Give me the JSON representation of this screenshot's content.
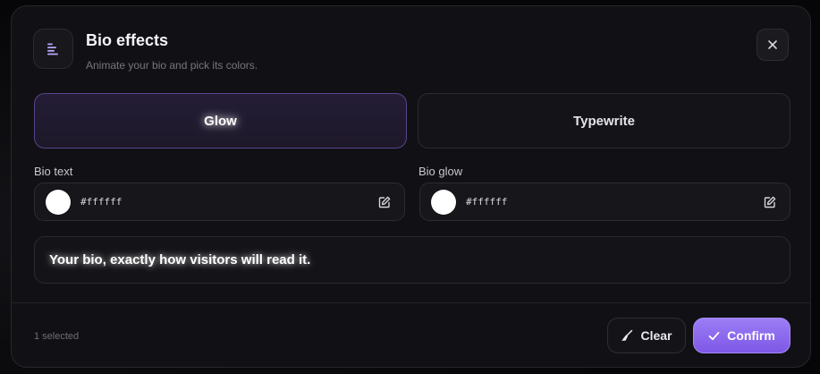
{
  "header": {
    "title": "Bio effects",
    "subtitle": "Animate your bio and pick its colors.",
    "icon": "text-align-left-icon",
    "close_icon": "close-icon"
  },
  "effects": {
    "tabs": [
      {
        "label": "Glow",
        "selected": true
      },
      {
        "label": "Typewrite",
        "selected": false
      }
    ]
  },
  "fields": {
    "bio_text": {
      "label": "Bio text",
      "value": "#ffffff",
      "color": "#ffffff",
      "icon": "edit-icon"
    },
    "bio_glow": {
      "label": "Bio glow",
      "value": "#ffffff",
      "color": "#ffffff",
      "icon": "edit-icon"
    }
  },
  "preview": {
    "text": "Your bio, exactly how visitors will read it."
  },
  "footer": {
    "selected_count": "1 selected",
    "clear_label": "Clear",
    "clear_icon": "broom-icon",
    "confirm_label": "Confirm",
    "confirm_icon": "check-icon"
  },
  "colors": {
    "accent": "#8b6cf0",
    "accent_border": "#5a4488",
    "background": "#111115"
  }
}
